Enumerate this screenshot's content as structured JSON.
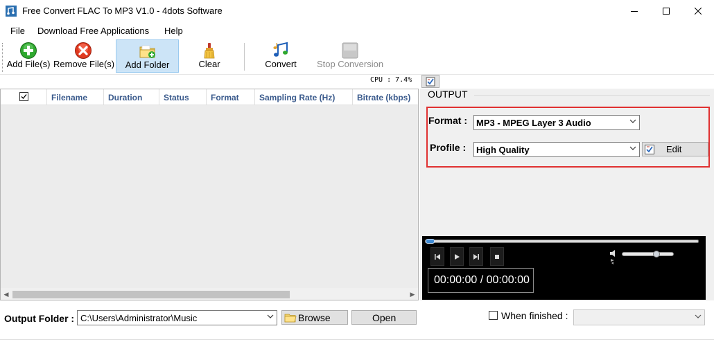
{
  "window": {
    "title": "Free Convert FLAC To MP3 V1.0 - 4dots Software",
    "icon": "app-icon",
    "controls": [
      "minimize-icon",
      "maximize-icon",
      "close-icon"
    ]
  },
  "menu": {
    "items": [
      "File",
      "Download Free Applications",
      "Help"
    ]
  },
  "toolbar": {
    "buttons": [
      {
        "label": "Add File(s)",
        "icon": "add-icon"
      },
      {
        "label": "Remove File(s)",
        "icon": "remove-icon"
      },
      {
        "label": "Add Folder",
        "icon": "folder-add-icon"
      },
      {
        "label": "Clear",
        "icon": "clear-brush-icon"
      },
      {
        "label": "Convert",
        "icon": "music-notes-icon"
      },
      {
        "label": "Stop Conversion",
        "icon": "stop-icon"
      }
    ],
    "active": "Add Folder",
    "disabled": "Stop Conversion"
  },
  "cpu": {
    "text": "CPU : 7.4%"
  },
  "file_list": {
    "columns": [
      "",
      "Filename",
      "Duration",
      "Status",
      "Format",
      "Sampling Rate (Hz)",
      "Bitrate (kbps)"
    ],
    "rows": []
  },
  "output": {
    "title": "OUTPUT",
    "format_label": "Format :",
    "format_value": "MP3 - MPEG Layer 3 Audio",
    "profile_label": "Profile :",
    "profile_value": "High Quality",
    "edit_label": "Edit",
    "highlight_color": "#e03131"
  },
  "player": {
    "time": "00:00:00 / 00:00:00",
    "seek_position": 0,
    "volume_level": 0.65
  },
  "bottom": {
    "output_folder_label": "Output Folder :",
    "output_folder_value": "C:\\Users\\Administrator\\Music",
    "browse_label": "Browse",
    "open_label": "Open",
    "when_finished_label": "When finished :",
    "when_finished_checked": false,
    "when_finished_value": ""
  },
  "colors": {
    "accent_selection": "#cce4f7",
    "header_text": "#3a5a8c",
    "player_bg": "#000000"
  }
}
